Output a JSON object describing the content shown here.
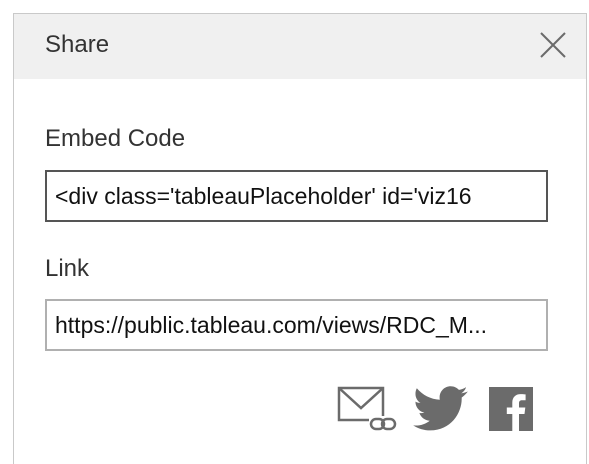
{
  "dialog": {
    "title": "Share",
    "close_icon": "close-x-icon"
  },
  "embed": {
    "label": "Embed Code",
    "value": "<div class='tableauPlaceholder' id='viz16"
  },
  "link": {
    "label": "Link",
    "value": "https://public.tableau.com/views/RDC_M..."
  },
  "share_icons": [
    {
      "name": "email-link-icon"
    },
    {
      "name": "twitter-icon"
    },
    {
      "name": "facebook-icon"
    }
  ],
  "colors": {
    "header_bg": "#f0f0f0",
    "icon_gray": "#6b6b6b",
    "text": "#333333"
  }
}
